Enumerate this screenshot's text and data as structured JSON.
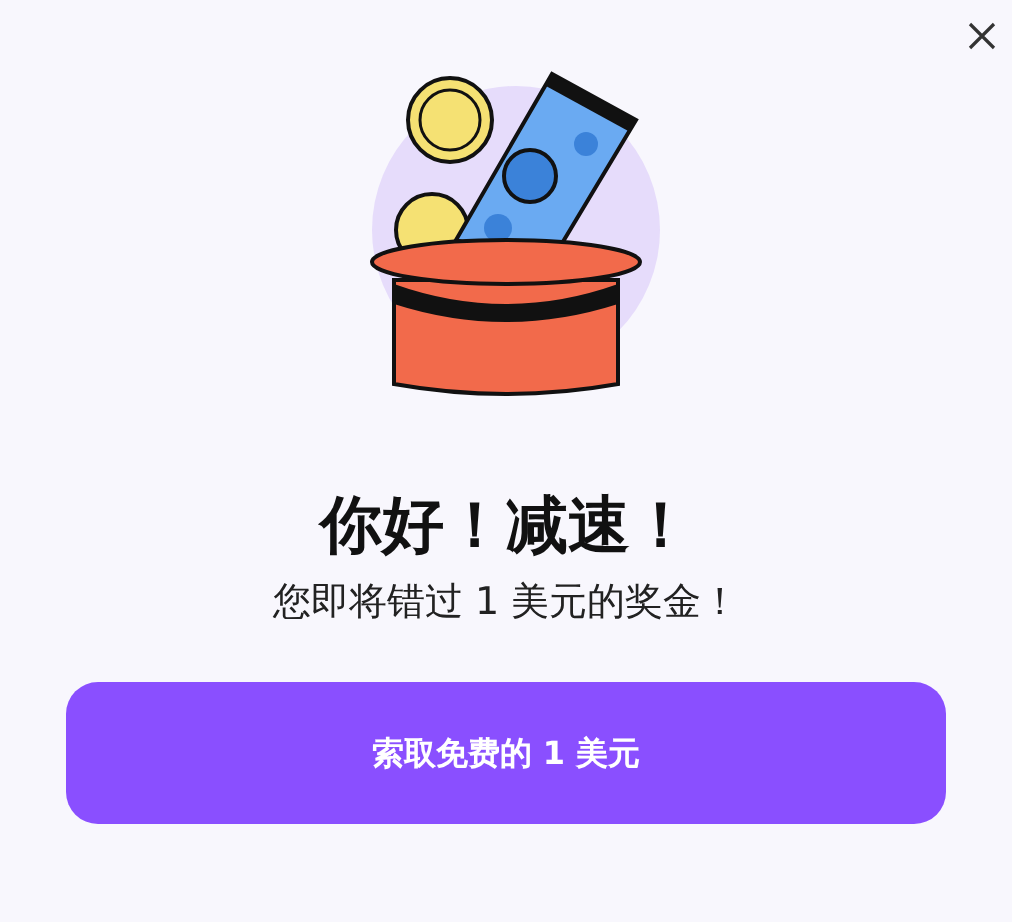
{
  "title": "你好！减速！",
  "subtitle": "您即将错过 1 美元的奖金！",
  "button": "索取免费的 1 美元"
}
